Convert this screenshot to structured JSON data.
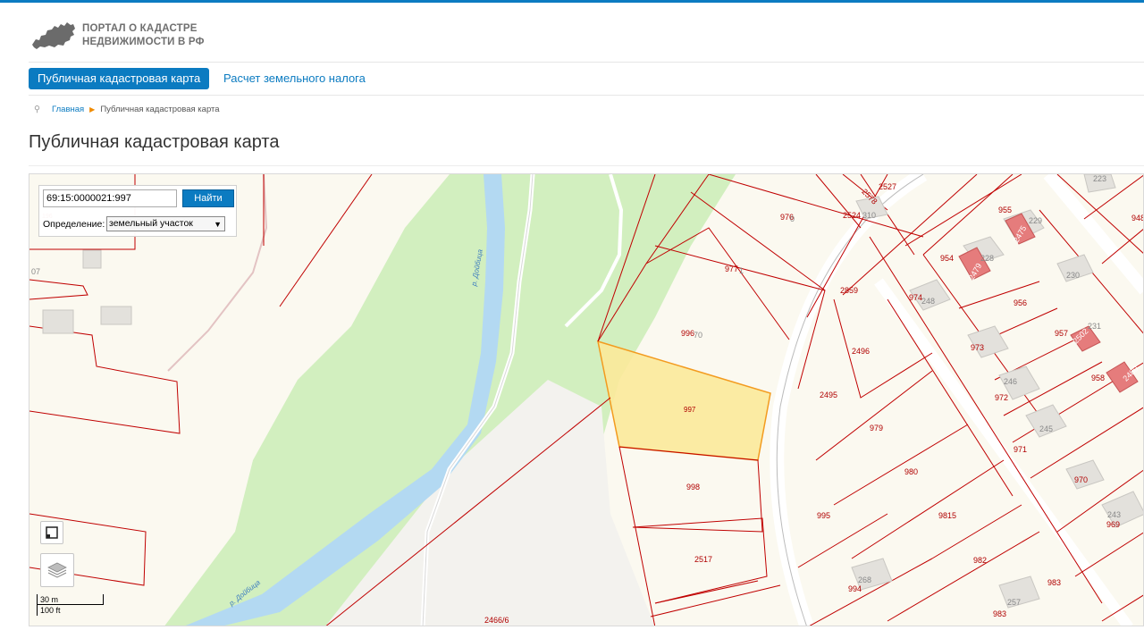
{
  "header": {
    "logo_line1": "ПОРТАЛ О КАДАСТРЕ",
    "logo_line2": "НЕДВИЖИМОСТИ В РФ",
    "brand_color": "#0b7bc1"
  },
  "nav": {
    "active_label": "Публичная кадастровая карта",
    "link_label": "Расчет земельного налога"
  },
  "breadcrumb": {
    "home": "Главная",
    "current": "Публичная кадастровая карта"
  },
  "page_title": "Публичная кадастровая карта",
  "map": {
    "search_value": "69:15:0000021:997",
    "search_button": "Найти",
    "definition_label": "Определение:",
    "definition_value": "земельный участок",
    "scale_metric": "30 m",
    "scale_imperial": "100 ft",
    "river_name": "р. Дойбица",
    "selected_parcel": "997",
    "parcel_labels": [
      "976",
      "977",
      "996",
      "997",
      "998",
      "2517",
      "2466/6",
      "2859",
      "2496",
      "2495",
      "979",
      "980",
      "9815",
      "982",
      "983",
      "995",
      "994",
      "954",
      "955",
      "956",
      "957",
      "958",
      "972",
      "971",
      "970",
      "969",
      "974",
      "973",
      "2524",
      "2527",
      "2578",
      "2475",
      "2479",
      "2502",
      "2480",
      "948"
    ],
    "building_labels": [
      "310",
      "229",
      "228",
      "230",
      "231",
      "248",
      "246",
      "245",
      "243",
      "268",
      "257",
      "223",
      "196",
      "07",
      "70",
      "1",
      "0"
    ],
    "colors": {
      "parcel_border": "#c00000",
      "selected_fill": "#fbe99a",
      "greenery": "#d2efbf",
      "river": "#b3d9f2",
      "background": "#fbf9f0"
    }
  }
}
